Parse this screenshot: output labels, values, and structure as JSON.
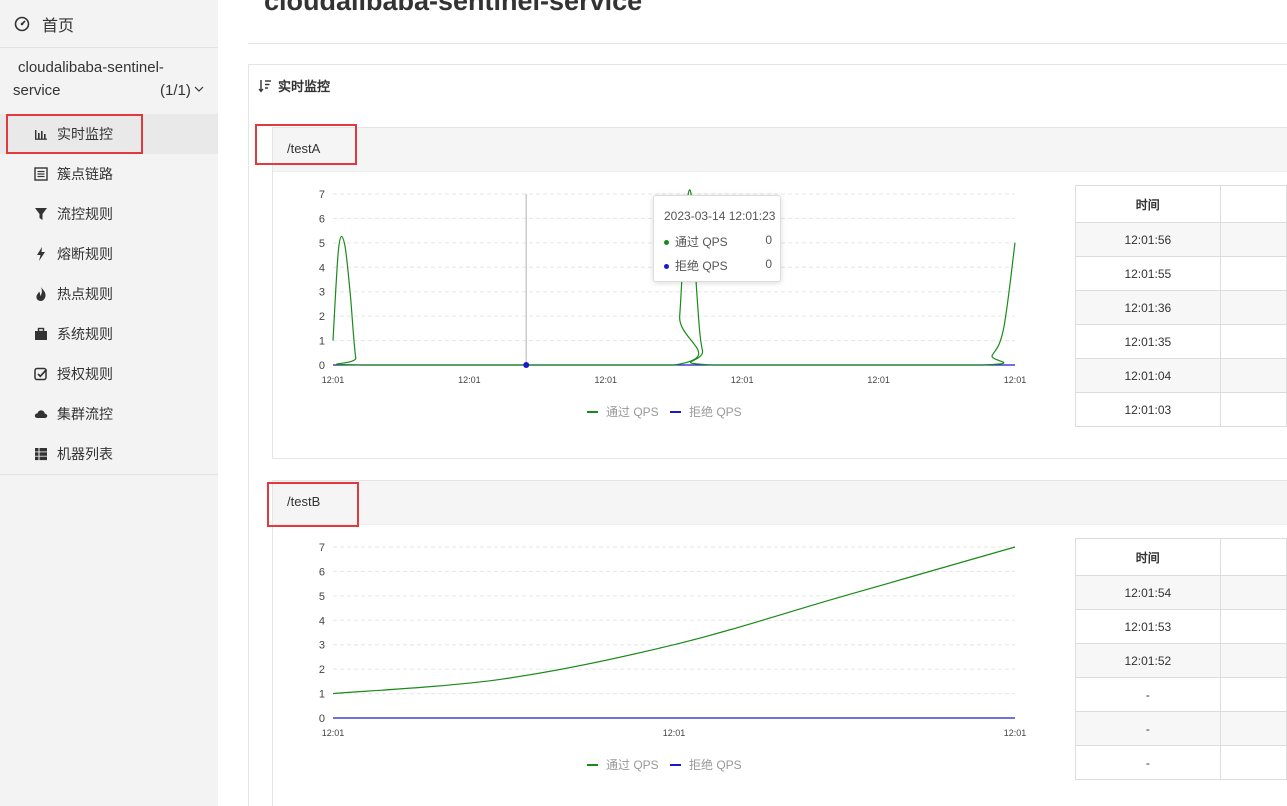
{
  "sidebar": {
    "home_label": "首页",
    "app_name_line1": "cloudalibaba-sentinel-",
    "app_name_line2": "service",
    "app_count": "(1/1)",
    "items": [
      {
        "label": "实时监控",
        "icon": "bar-chart-icon",
        "active": true
      },
      {
        "label": "簇点链路",
        "icon": "list-icon"
      },
      {
        "label": "流控规则",
        "icon": "filter-icon"
      },
      {
        "label": "熔断规则",
        "icon": "bolt-icon"
      },
      {
        "label": "热点规则",
        "icon": "fire-icon"
      },
      {
        "label": "系统规则",
        "icon": "briefcase-icon"
      },
      {
        "label": "授权规则",
        "icon": "check-square-icon"
      },
      {
        "label": "集群流控",
        "icon": "cloud-icon"
      },
      {
        "label": "机器列表",
        "icon": "th-list-icon"
      }
    ]
  },
  "main": {
    "title": "cloudalibaba-sentinel-service",
    "panel_title": "实时监控"
  },
  "cards": [
    {
      "resource": "/testA",
      "legend": [
        "通过 QPS",
        "拒绝 QPS"
      ],
      "table": {
        "header": "时间",
        "rows": [
          "12:01:56",
          "12:01:55",
          "12:01:36",
          "12:01:35",
          "12:01:04",
          "12:01:03"
        ]
      },
      "tooltip": {
        "time": "2023-03-14 12:01:23",
        "pass_label": "通过 QPS",
        "pass_value": "0",
        "block_label": "拒绝 QPS",
        "block_value": "0"
      }
    },
    {
      "resource": "/testB",
      "legend": [
        "通过 QPS",
        "拒绝 QPS"
      ],
      "table": {
        "header": "时间",
        "rows": [
          "12:01:54",
          "12:01:53",
          "12:01:52",
          "-",
          "-",
          "-"
        ]
      }
    }
  ],
  "colors": {
    "pass": "#1a8a1a",
    "block": "#1a1acc",
    "highlight_box": "#e0393e"
  },
  "chart_data": [
    {
      "type": "line",
      "title": "/testA",
      "ylim": [
        0,
        7
      ],
      "yticks": [
        0,
        1,
        2,
        3,
        4,
        5,
        6,
        7
      ],
      "xticks": [
        "12:01",
        "12:01",
        "12:01",
        "12:01",
        "12:01",
        "12:01"
      ],
      "legend_position": "bottom",
      "series": [
        {
          "name": "通过 QPS",
          "color": "#1a8a1a",
          "points": [
            [
              0,
              1
            ],
            [
              0.5,
              4.8
            ],
            [
              1,
              5
            ],
            [
              1.5,
              3
            ],
            [
              2,
              0.3
            ],
            [
              2.5,
              0
            ],
            [
              30,
              0
            ],
            [
              30.5,
              2
            ],
            [
              31,
              6
            ],
            [
              31.5,
              7
            ],
            [
              32,
              3
            ],
            [
              32.5,
              0.6
            ],
            [
              33.5,
              0
            ],
            [
              57,
              0
            ],
            [
              58,
              0.4
            ],
            [
              59,
              1.5
            ],
            [
              60,
              5
            ]
          ]
        },
        {
          "name": "拒绝 QPS",
          "color": "#1a1acc",
          "points": [
            [
              0,
              0
            ],
            [
              60,
              0
            ]
          ]
        }
      ]
    },
    {
      "type": "line",
      "title": "/testB",
      "ylim": [
        0,
        7
      ],
      "yticks": [
        0,
        1,
        2,
        3,
        4,
        5,
        6,
        7
      ],
      "xticks": [
        "12:01",
        "12:01",
        "12:01"
      ],
      "legend_position": "bottom",
      "series": [
        {
          "name": "通过 QPS",
          "color": "#1a8a1a",
          "points": [
            [
              0,
              1
            ],
            [
              1,
              1.6
            ],
            [
              2,
              3
            ],
            [
              3,
              5
            ],
            [
              4,
              7
            ]
          ]
        },
        {
          "name": "拒绝 QPS",
          "color": "#1a1acc",
          "points": [
            [
              0,
              0
            ],
            [
              4,
              0
            ]
          ]
        }
      ]
    }
  ]
}
